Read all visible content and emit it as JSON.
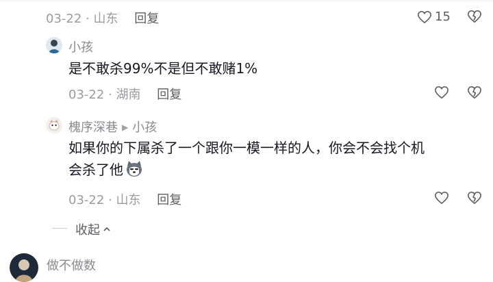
{
  "top_comment": {
    "date": "03-22",
    "location": "山东",
    "reply_label": "回复",
    "like_count": "15"
  },
  "reply1": {
    "author": "小孩",
    "text": "是不敢杀99%不是但不敢赌1%",
    "date": "03-22",
    "location": "湖南",
    "reply_label": "回复"
  },
  "reply2": {
    "author": "槐序深巷",
    "reply_to": "小孩",
    "text_line1": "如果你的下属杀了一个跟你一模一样的人，你会不会找个机",
    "text_line2": "会杀了他",
    "date": "03-22",
    "location": "山东",
    "reply_label": "回复"
  },
  "collapse": {
    "label": "收起"
  },
  "next_comment": {
    "author": "做不做数"
  },
  "icons": {
    "like": "heart-icon",
    "dislike": "broken-heart-icon",
    "collapse": "chevron-up-icon",
    "emoji": "husky-emoji-icon"
  },
  "colors": {
    "meta": "#9a9ba1",
    "name": "#8a8b91",
    "text": "#161823"
  }
}
